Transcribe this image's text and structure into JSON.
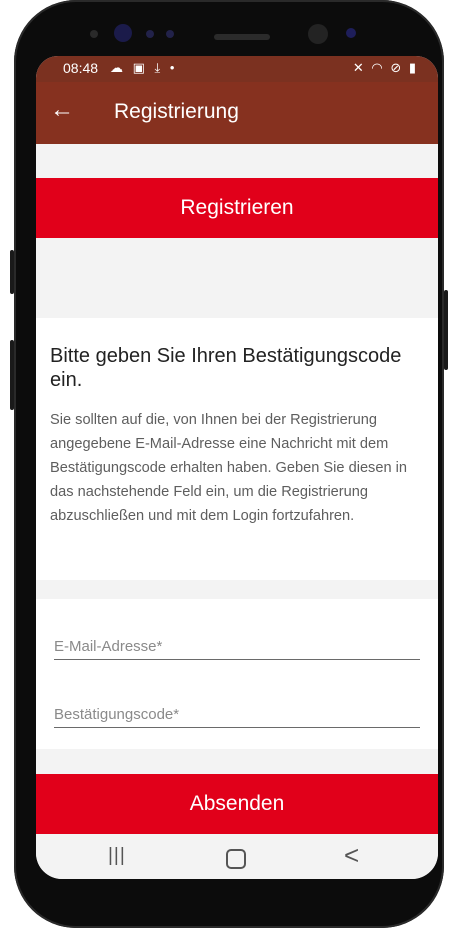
{
  "statusbar": {
    "time": "08:48",
    "left_icons": "☁ ▣ ⤓ •",
    "right_icons": "✕ ◠ ⊘ ▮"
  },
  "appbar": {
    "back_icon": "←",
    "title": "Registrierung"
  },
  "register_button": {
    "label": "Registrieren"
  },
  "info": {
    "headline": "Bitte geben Sie Ihren Bestätigungscode ein.",
    "body": "Sie sollten auf die, von Ihnen bei der Registrierung angegebene E-Mail-Adresse eine Nachricht mit dem Bestätigungscode erhalten haben. Geben Sie diesen in das nachstehende Feld ein, um die Registrierung abzuschließen und mit dem Login fortzufahren."
  },
  "form": {
    "email_placeholder": "E-Mail-Adresse*",
    "code_placeholder": "Bestätigungscode*"
  },
  "submit_button": {
    "label": "Absenden"
  },
  "navbar": {
    "recent_icon": "|||",
    "home_icon": "home",
    "back_icon": "<"
  },
  "colors": {
    "appbar": "#86311f",
    "statusbar": "#7b3120",
    "accent": "#e1001a",
    "background": "#f3f3f3"
  }
}
